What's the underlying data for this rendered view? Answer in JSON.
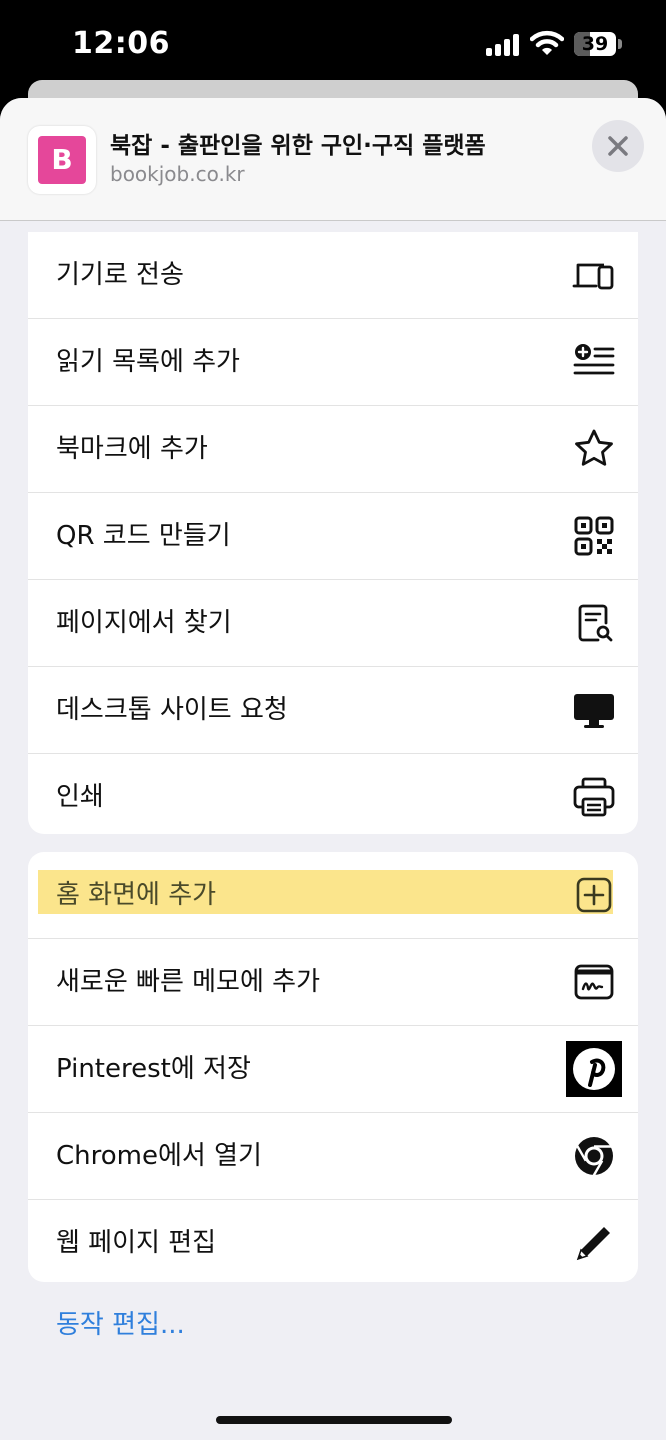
{
  "status_bar": {
    "time": "12:06",
    "battery_level": 39,
    "battery_label": "39"
  },
  "sheet": {
    "favicon_letter": "B",
    "favicon_color": "#e5479a",
    "site_title": "북잡 - 출판인을 위한 구인·구직 플랫폼",
    "site_url": "bookjob.co.kr",
    "close_icon": "close-icon"
  },
  "actions_group1": [
    {
      "label": "기기로 전송",
      "icon": "devices-icon"
    },
    {
      "label": "읽기 목록에 추가",
      "icon": "reading-list-icon"
    },
    {
      "label": "북마크에 추가",
      "icon": "star-icon"
    },
    {
      "label": "QR 코드 만들기",
      "icon": "qr-code-icon"
    },
    {
      "label": "페이지에서 찾기",
      "icon": "find-in-page-icon"
    },
    {
      "label": "데스크톱 사이트 요청",
      "icon": "desktop-icon"
    },
    {
      "label": "인쇄",
      "icon": "printer-icon"
    }
  ],
  "actions_group2": [
    {
      "label": "홈 화면에 추가",
      "icon": "add-square-icon",
      "highlighted": true
    },
    {
      "label": "새로운 빠른 메모에 추가",
      "icon": "quick-note-icon"
    },
    {
      "label": "Pinterest에 저장",
      "icon": "pinterest-icon"
    },
    {
      "label": "Chrome에서 열기",
      "icon": "chrome-icon"
    },
    {
      "label": "웹 페이지 편집",
      "icon": "pencil-icon"
    }
  ],
  "edit_actions_label": "동작 편집...",
  "colors": {
    "accent": "#2f7fdc",
    "highlight": "#fbe58c",
    "sheet_bg": "#efeff4"
  }
}
